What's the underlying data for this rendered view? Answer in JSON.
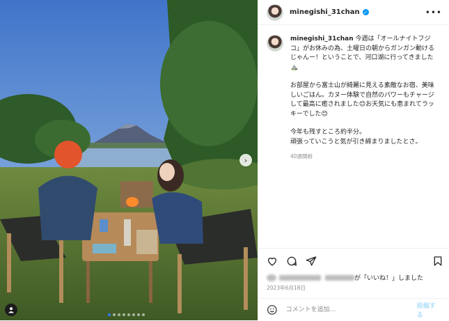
{
  "post": {
    "username": "minegishi_31chan",
    "verified_icon": "verified-badge-icon",
    "more_icon": "more-options-icon"
  },
  "caption": {
    "username": "minegishi_31chan",
    "line1": "今週は「オールナイトフジコ」がお休みの為、土曜日の朝からガンガン動けるじゃんー！ということで、河口湖に行ってきました⛰️",
    "para2": "お部屋から富士山が綺麗に見える素敵なお宿、美味しいごはん。カヌー体験で自然のパワーもチャージして最高に癒されました😊お天気にも恵まれてラッキーでした😊",
    "para3a": "今年も残すところ約半分。",
    "para3b": "頑張っていこうと気が引き締まりましたとさ。",
    "time": "40週間前"
  },
  "actions": {
    "icons": [
      "heart-icon",
      "comment-icon",
      "share-icon",
      "bookmark-icon"
    ],
    "likes_suffix": "が「いいね！」しました",
    "date": "2023年6月18日"
  },
  "comment": {
    "placeholder": "コメントを追加...",
    "post_label": "投稿する"
  },
  "carousel": {
    "count": 8,
    "active": 1
  }
}
